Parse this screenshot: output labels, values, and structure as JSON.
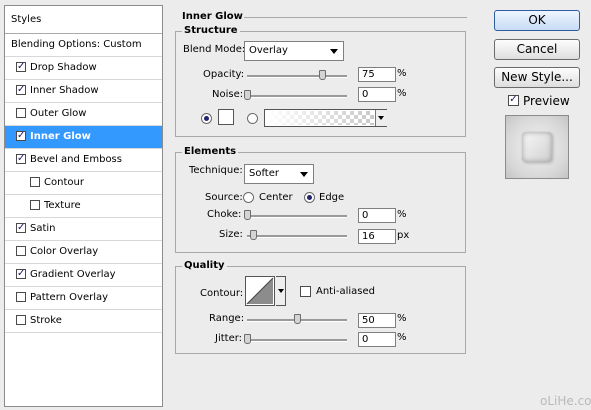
{
  "styles_panel": {
    "header": "Styles",
    "blending_options": "Blending Options: Custom",
    "items": [
      {
        "label": "Drop Shadow",
        "checked": true,
        "indent": 0,
        "selected": false
      },
      {
        "label": "Inner Shadow",
        "checked": true,
        "indent": 0,
        "selected": false
      },
      {
        "label": "Outer Glow",
        "checked": false,
        "indent": 0,
        "selected": false
      },
      {
        "label": "Inner Glow",
        "checked": true,
        "indent": 0,
        "selected": true
      },
      {
        "label": "Bevel and Emboss",
        "checked": true,
        "indent": 0,
        "selected": false
      },
      {
        "label": "Contour",
        "checked": false,
        "indent": 1,
        "selected": false
      },
      {
        "label": "Texture",
        "checked": false,
        "indent": 1,
        "selected": false
      },
      {
        "label": "Satin",
        "checked": true,
        "indent": 0,
        "selected": false
      },
      {
        "label": "Color Overlay",
        "checked": false,
        "indent": 0,
        "selected": false
      },
      {
        "label": "Gradient Overlay",
        "checked": true,
        "indent": 0,
        "selected": false
      },
      {
        "label": "Pattern Overlay",
        "checked": false,
        "indent": 0,
        "selected": false
      },
      {
        "label": "Stroke",
        "checked": false,
        "indent": 0,
        "selected": false
      }
    ]
  },
  "inner_glow": {
    "title": "Inner Glow",
    "structure": {
      "title": "Structure",
      "blend_mode_label": "Blend Mode:",
      "blend_mode_value": "Overlay",
      "opacity_label": "Opacity:",
      "opacity_value": "75",
      "opacity_pct": 0.75,
      "noise_label": "Noise:",
      "noise_value": "0",
      "noise_pct": 0,
      "unit": "%"
    },
    "elements": {
      "title": "Elements",
      "technique_label": "Technique:",
      "technique_value": "Softer",
      "source_label": "Source:",
      "source_center": "Center",
      "source_edge": "Edge",
      "choke_label": "Choke:",
      "choke_value": "0",
      "choke_pct": 0,
      "size_label": "Size:",
      "size_value": "16",
      "size_pct": 0.064,
      "pct_unit": "%",
      "px_unit": "px"
    },
    "quality": {
      "title": "Quality",
      "contour_label": "Contour:",
      "anti_aliased_label": "Anti-aliased",
      "range_label": "Range:",
      "range_value": "50",
      "range_pct": 0.5,
      "jitter_label": "Jitter:",
      "jitter_value": "0",
      "jitter_pct": 0,
      "unit": "%"
    }
  },
  "buttons": {
    "ok": "OK",
    "cancel": "Cancel",
    "new_style": "New Style...",
    "preview_label": "Preview"
  },
  "watermark": "oLiHe.com",
  "colors": {
    "selection": "#3399ff",
    "dialog_bg": "#ececec"
  }
}
